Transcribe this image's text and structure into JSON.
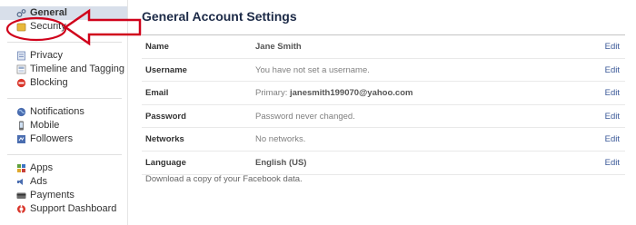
{
  "sidebar": {
    "groups": [
      [
        {
          "label": "General",
          "icon": "gear-icon",
          "active": true
        },
        {
          "label": "Security",
          "icon": "security-icon",
          "active": false
        }
      ],
      [
        {
          "label": "Privacy",
          "icon": "privacy-icon"
        },
        {
          "label": "Timeline and Tagging",
          "icon": "timeline-icon"
        },
        {
          "label": "Blocking",
          "icon": "blocking-icon"
        }
      ],
      [
        {
          "label": "Notifications",
          "icon": "globe-icon"
        },
        {
          "label": "Mobile",
          "icon": "mobile-icon"
        },
        {
          "label": "Followers",
          "icon": "followers-icon"
        }
      ],
      [
        {
          "label": "Apps",
          "icon": "apps-icon"
        },
        {
          "label": "Ads",
          "icon": "ads-icon"
        },
        {
          "label": "Payments",
          "icon": "payments-icon"
        },
        {
          "label": "Support Dashboard",
          "icon": "lifebuoy-icon"
        }
      ]
    ]
  },
  "main": {
    "title": "General Account Settings",
    "rows": [
      {
        "name": "Name",
        "value": "Jane Smith",
        "edit": "Edit"
      },
      {
        "name": "Username",
        "value": "You have not set a username.",
        "edit": "Edit"
      },
      {
        "name": "Email",
        "value_prefix": "Primary: ",
        "value": "janesmith199070@yahoo.com",
        "edit": "Edit"
      },
      {
        "name": "Password",
        "value": "Password never changed.",
        "edit": "Edit"
      },
      {
        "name": "Networks",
        "value": "No networks.",
        "edit": "Edit"
      },
      {
        "name": "Language",
        "value": "English (US)",
        "edit": "Edit"
      }
    ],
    "download_text": "Download a copy of your Facebook data."
  },
  "colors": {
    "annotation": "#d0021b",
    "link": "#3b5998",
    "active_bg": "#d8dfea"
  }
}
